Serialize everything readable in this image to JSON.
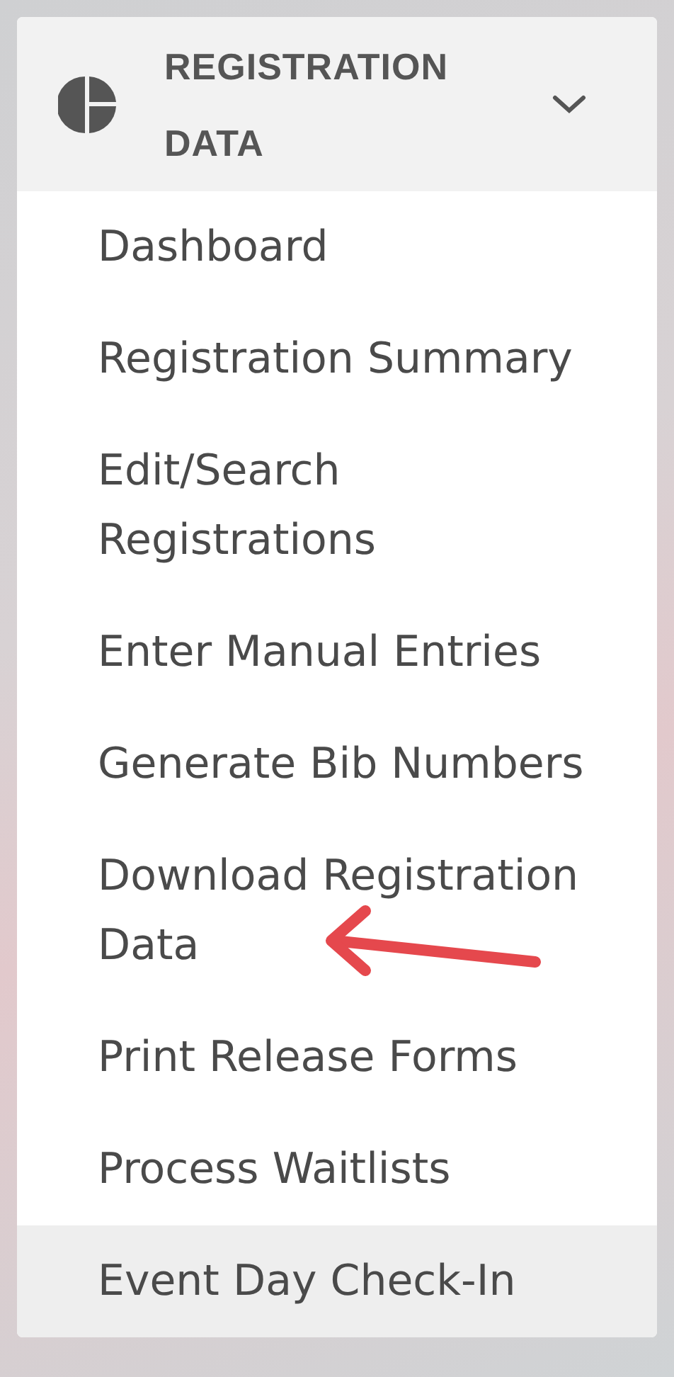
{
  "menu": {
    "title": "REGISTRATION DATA",
    "expanded": true,
    "items": [
      {
        "label": "Dashboard",
        "highlighted": false
      },
      {
        "label": "Registration Summary",
        "highlighted": false
      },
      {
        "label": "Edit/Search Registrations",
        "highlighted": false
      },
      {
        "label": "Enter Manual Entries",
        "highlighted": false
      },
      {
        "label": "Generate Bib Numbers",
        "highlighted": false
      },
      {
        "label": "Download Registration Data",
        "highlighted": false,
        "annotated": true
      },
      {
        "label": "Print Release Forms",
        "highlighted": false
      },
      {
        "label": "Process Waitlists",
        "highlighted": false
      },
      {
        "label": "Event Day Check-In",
        "highlighted": true
      }
    ]
  }
}
